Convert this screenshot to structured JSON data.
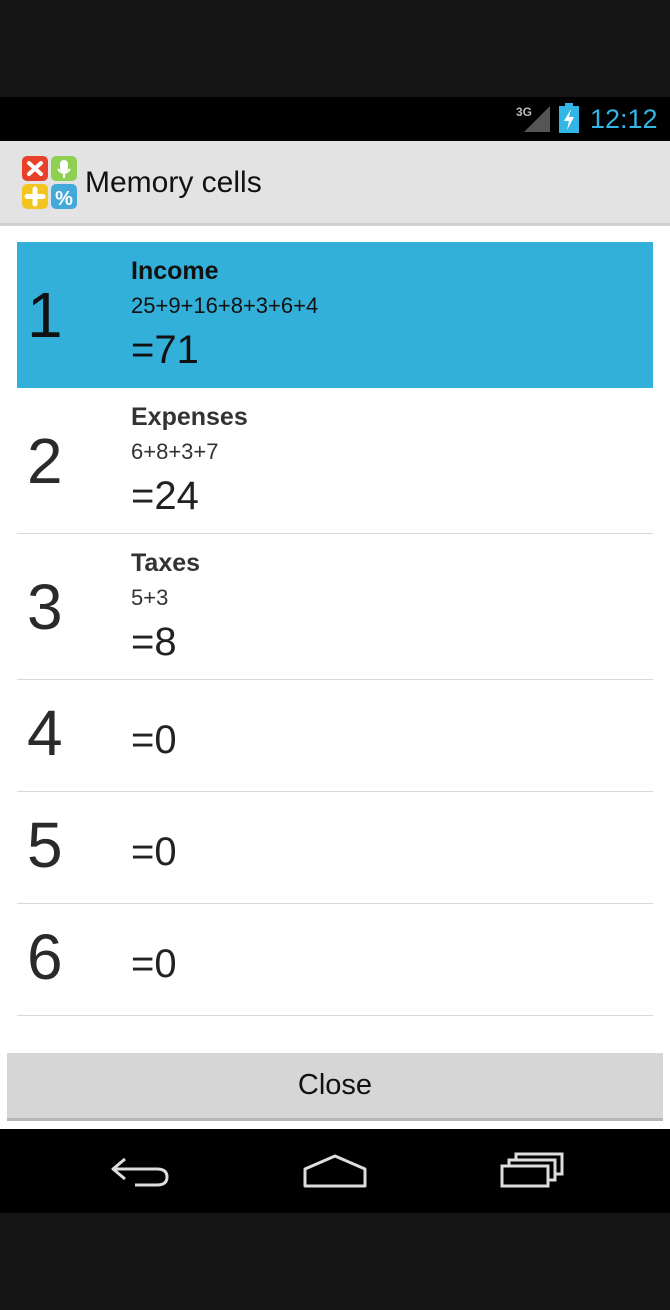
{
  "status_bar": {
    "network": "3G",
    "network_icon": "signal-3g-icon",
    "battery_icon": "battery-charging-icon",
    "time": "12:12",
    "accent_color": "#33b5e5"
  },
  "titlebar": {
    "app_icon": "calculator-app-icon",
    "title": "Memory cells"
  },
  "cells": [
    {
      "number": "1",
      "name": "Income",
      "expression": "25+9+16+8+3+6+4",
      "result": "=71",
      "selected": true
    },
    {
      "number": "2",
      "name": "Expenses",
      "expression": "6+8+3+7",
      "result": "=24",
      "selected": false
    },
    {
      "number": "3",
      "name": "Taxes",
      "expression": "5+3",
      "result": "=8",
      "selected": false
    },
    {
      "number": "4",
      "name": "",
      "expression": "",
      "result": "=0",
      "selected": false
    },
    {
      "number": "5",
      "name": "",
      "expression": "",
      "result": "=0",
      "selected": false
    },
    {
      "number": "6",
      "name": "",
      "expression": "",
      "result": "=0",
      "selected": false
    }
  ],
  "selected_color": "#33b0da",
  "close_label": "Close",
  "nav": {
    "back_icon": "back-icon",
    "home_icon": "home-icon",
    "recents_icon": "recent-apps-icon"
  }
}
